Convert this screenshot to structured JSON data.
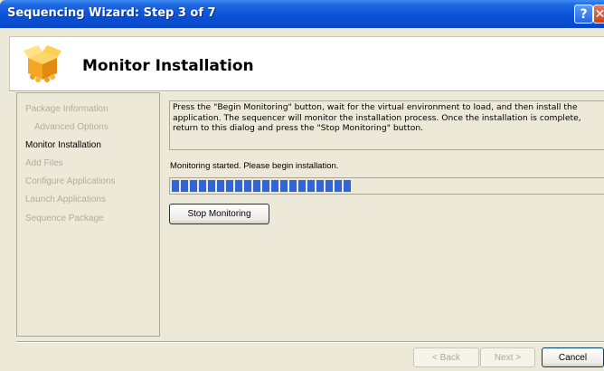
{
  "window": {
    "title": "Sequencing Wizard: Step 3 of 7",
    "help_label": "?",
    "close_label": "✕"
  },
  "header": {
    "title": "Monitor Installation",
    "logo_icon": "package-box-icon"
  },
  "steps": [
    {
      "label": "Package Information",
      "state": "disabled"
    },
    {
      "label": "Advanced Options",
      "state": "disabled"
    },
    {
      "label": "Monitor Installation",
      "state": "active"
    },
    {
      "label": "Add Files",
      "state": "disabled"
    },
    {
      "label": "Configure Applications",
      "state": "disabled"
    },
    {
      "label": "Launch Applications",
      "state": "disabled"
    },
    {
      "label": "Sequence Package",
      "state": "disabled"
    }
  ],
  "main": {
    "instructions": "Press the \"Begin Monitoring\" button, wait for the virtual environment to load, and then install the application.  The sequencer will monitor the installation process.  Once the installation is complete, return to this dialog and press the \"Stop Monitoring\" button.",
    "status": "Monitoring started.  Please begin installation.",
    "progress_segments": 20,
    "stop_label": "Stop Monitoring"
  },
  "footer": {
    "back_label": "< Back",
    "next_label": "Next >",
    "cancel_label": "Cancel"
  },
  "colors": {
    "titlebar": "#0a52d8",
    "progress": "#3165d6",
    "disabled_text": "#b1ae9e"
  }
}
